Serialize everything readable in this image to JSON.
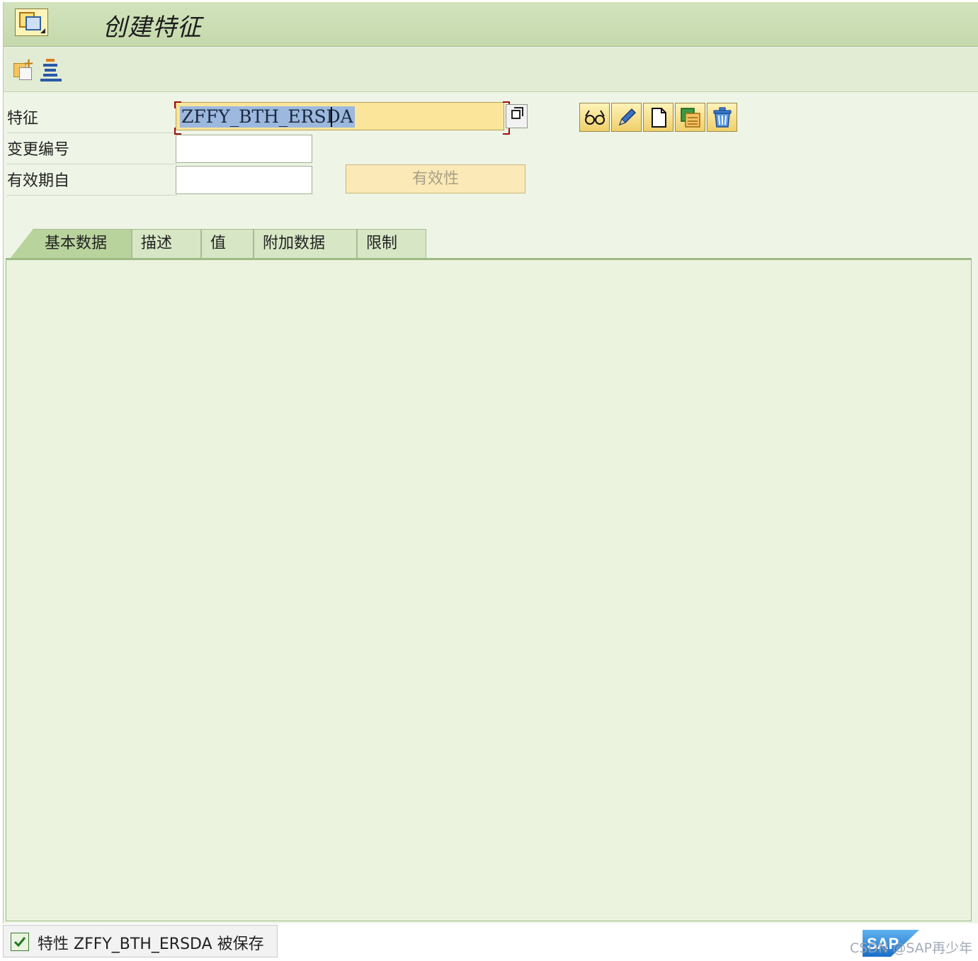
{
  "window": {
    "title": "创建特征",
    "title_icon": "transaction-icon"
  },
  "toolbar": {
    "buttons": [
      {
        "name": "copy-from-icon"
      },
      {
        "name": "list-icon"
      }
    ]
  },
  "form": {
    "characteristic": {
      "label": "特征",
      "value": "ZFFY_BTH_ERSDA"
    },
    "change_number": {
      "label": "变更编号",
      "value": ""
    },
    "valid_from": {
      "label": "有效期自",
      "value": ""
    },
    "validity_button": "有效性",
    "actions": [
      "display-icon",
      "change-icon",
      "create-icon",
      "copy-icon",
      "delete-icon"
    ]
  },
  "tabs": [
    "基本数据",
    "描述",
    "值",
    "附加数据",
    "限制"
  ],
  "status": {
    "text": "特性 ZFFY_BTH_ERSDA 被保存",
    "icon": "success-check-icon"
  },
  "branding": {
    "logo": "SAP",
    "watermark": "CSDN @SAP再少年"
  }
}
